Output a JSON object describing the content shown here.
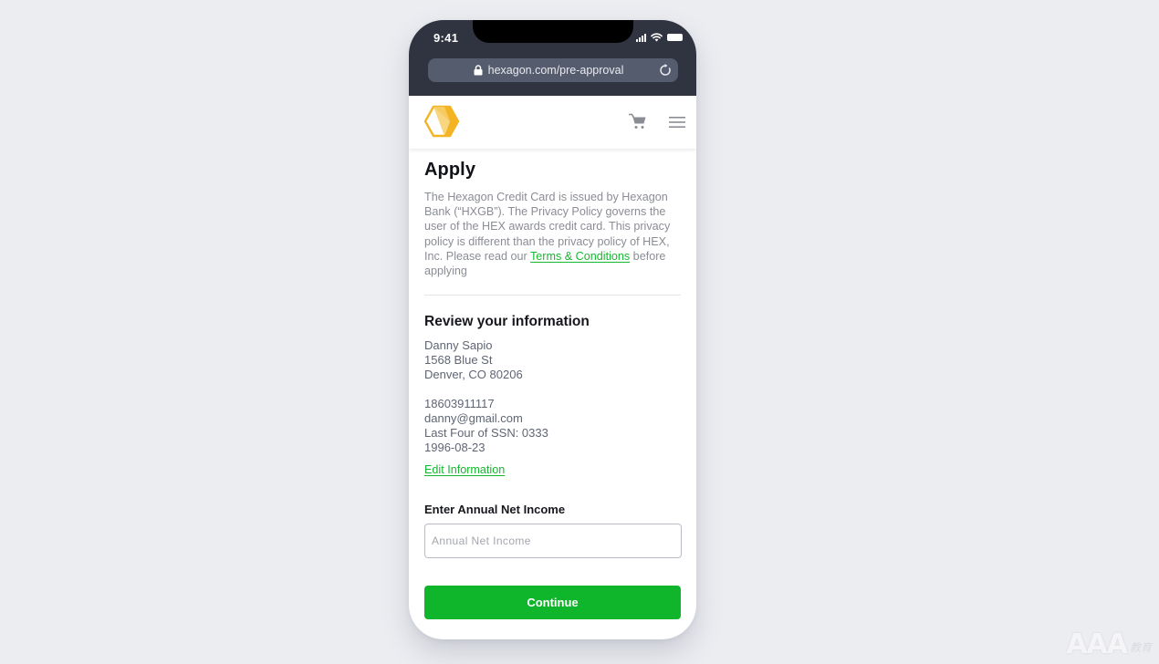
{
  "status_bar": {
    "time": "9:41",
    "icons": [
      "signal-icon",
      "wifi-icon",
      "battery-icon"
    ]
  },
  "browser": {
    "url": "hexagon.com/pre-approval",
    "icons": [
      "lock-icon",
      "reload-icon"
    ]
  },
  "navbar": {
    "logo": "hexagon-logo",
    "icons": [
      "cart-icon",
      "hamburger-menu-icon"
    ]
  },
  "colors": {
    "accent_green": "#0fb52a",
    "link_green": "#16b82f",
    "logo_yellow": "#f3b323",
    "header_dark": "#2f3440"
  },
  "page": {
    "title": "Apply",
    "disclaimer": "The Hexagon Credit Card is issued by Hexagon Bank (“HXGB”). The Privacy Policy governs the user of the HEX awards credit card. This privacy policy is different than the privacy policy of HEX, Inc. Please read our",
    "terms_link": "Terms & Conditions",
    "disclaimer_suffix": " before applying",
    "review": {
      "title": "Review your information",
      "address_lines": [
        "Danny Sapio",
        "1568 Blue St",
        "Denver, CO 80206"
      ],
      "contact_lines": [
        "18603911117",
        "danny@gmail.com",
        "Last Four of SSN: 0333",
        "1996-08-23"
      ],
      "edit_link": "Edit Information"
    },
    "income": {
      "label": "Enter Annual Net Income",
      "placeholder": "Annual Net Income",
      "value": ""
    },
    "continue_label": "Continue"
  },
  "watermark": {
    "main": "AAA",
    "sub": "教育"
  }
}
